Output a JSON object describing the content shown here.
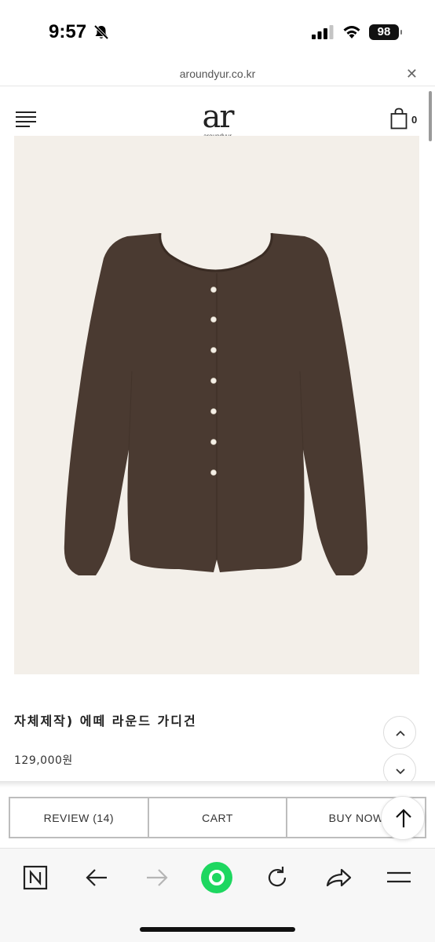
{
  "status_bar": {
    "time": "9:57",
    "battery": "98"
  },
  "url_bar": {
    "url": "aroundyur.co.kr"
  },
  "header": {
    "logo_mark": "ar",
    "logo_text": "aroundyur",
    "cart_count": "0"
  },
  "product": {
    "name": "자체제작) 에떼 라운드 가디건",
    "price": "129,000원",
    "color": "#4a3a31",
    "background": "#f3efe9"
  },
  "actions": {
    "review": "REVIEW (14)",
    "cart": "CART",
    "buy": "BUY NOW"
  },
  "colors": {
    "accent_green": "#1ed760",
    "border": "#bdbdbd"
  },
  "browser_nav": {
    "items": [
      "naver-icon",
      "back-icon",
      "forward-icon",
      "home-circle-icon",
      "reload-icon",
      "share-icon",
      "menu-icon"
    ]
  }
}
